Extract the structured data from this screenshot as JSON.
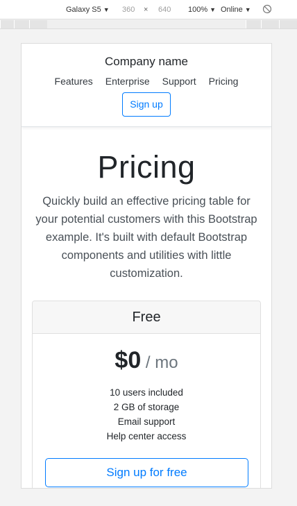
{
  "devtools": {
    "device": "Galaxy S5",
    "width": "360",
    "times": "×",
    "height": "640",
    "zoom": "100%",
    "throttle": "Online",
    "caret": "▼"
  },
  "header": {
    "brand": "Company name",
    "nav": [
      "Features",
      "Enterprise",
      "Support",
      "Pricing"
    ],
    "signup_label": "Sign up"
  },
  "hero": {
    "title": "Pricing",
    "lead": "Quickly build an effective pricing table for your potential customers with this Bootstrap example. It's built with default Bootstrap components and utilities with little customization."
  },
  "plan": {
    "name": "Free",
    "price": "$0",
    "period": " / mo",
    "features": [
      "10 users included",
      "2 GB of storage",
      "Email support",
      "Help center access"
    ],
    "button_label": "Sign up for free"
  },
  "colors": {
    "primary": "#007bff",
    "text": "#212529",
    "muted": "#6c757d"
  }
}
